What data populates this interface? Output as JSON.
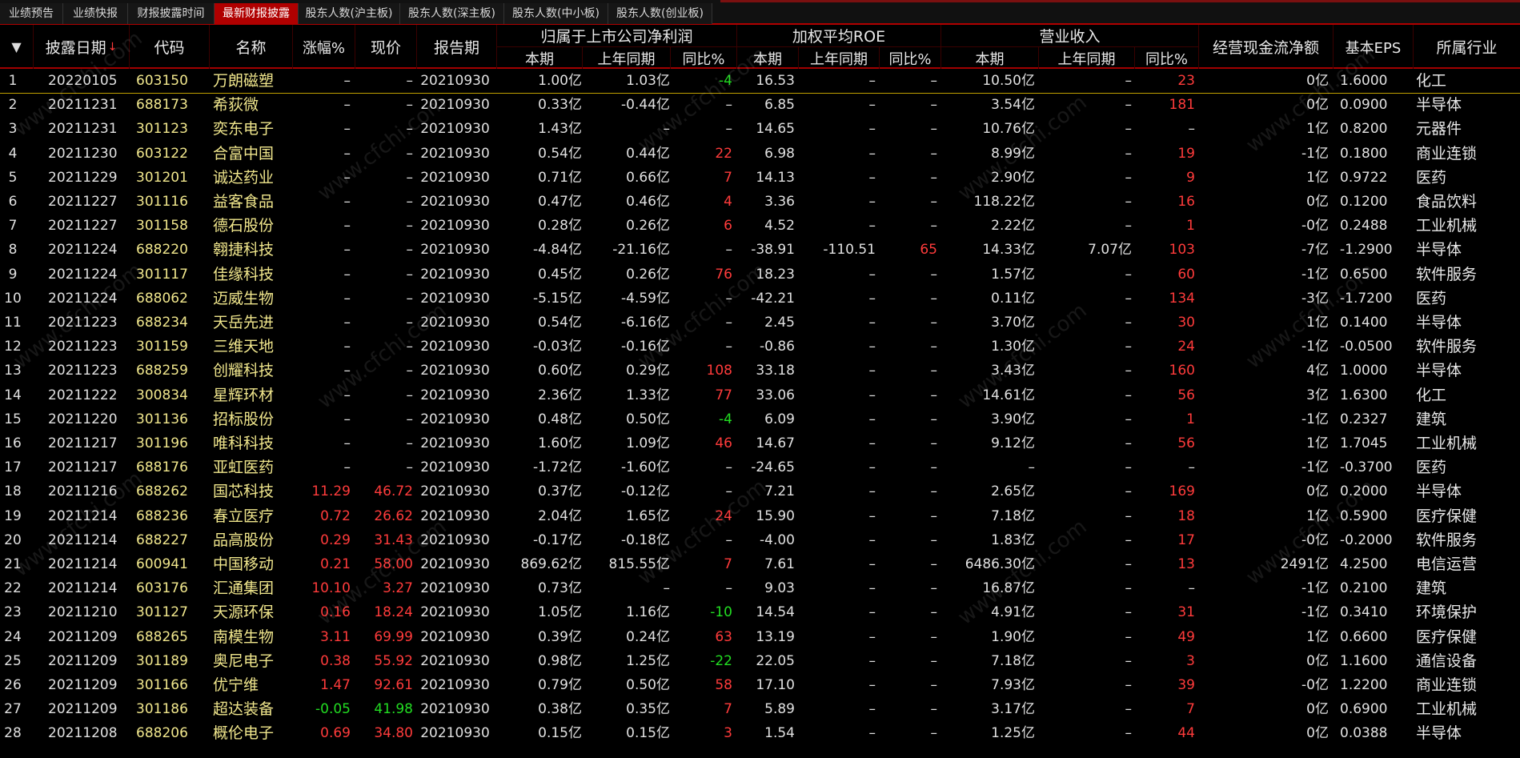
{
  "tabs": [
    "业绩预告",
    "业绩快报",
    "财报披露时间",
    "最新财报披露",
    "股东人数(沪主板)",
    "股东人数(深主板)",
    "股东人数(中小板)",
    "股东人数(创业板)"
  ],
  "active_tab": 3,
  "header": {
    "menu_icon": "▼",
    "date": "披露日期",
    "sort_icon": "↓",
    "code": "代码",
    "name": "名称",
    "change": "涨幅%",
    "price": "现价",
    "period": "报告期",
    "net_profit_group": "归属于上市公司净利润",
    "roe_group": "加权平均ROE",
    "revenue_group": "营业收入",
    "current": "本期",
    "prev": "上年同期",
    "yoy": "同比%",
    "cashflow": "经营现金流净额",
    "eps": "基本EPS",
    "industry": "所属行业"
  },
  "watermark": "www.cfchi.com",
  "colors": {
    "red": "#ff3b3b",
    "green": "#22dd22",
    "default": "#e0e0e0",
    "name": "#f0e68c",
    "accent": "#b00000"
  },
  "rows": [
    {
      "idx": "1",
      "date": "20220105",
      "code": "603150",
      "name": "万朗磁塑",
      "chg": "–",
      "price": "–",
      "period": "20210930",
      "np_cur": "1.00亿",
      "np_prev": "1.03亿",
      "np_yoy": "-4",
      "np_yoy_c": "green",
      "roe_cur": "16.53",
      "roe_prev": "–",
      "roe_yoy": "–",
      "roe_yoy_c": "",
      "rev_cur": "10.50亿",
      "rev_prev": "–",
      "rev_yoy": "23",
      "rev_yoy_c": "red",
      "cash": "0亿",
      "eps": "1.6000",
      "ind": "化工",
      "chg_c": ""
    },
    {
      "idx": "2",
      "date": "20211231",
      "code": "688173",
      "name": "希荻微",
      "chg": "–",
      "price": "–",
      "period": "20210930",
      "np_cur": "0.33亿",
      "np_prev": "-0.44亿",
      "np_yoy": "–",
      "np_yoy_c": "",
      "roe_cur": "6.85",
      "roe_prev": "–",
      "roe_yoy": "–",
      "roe_yoy_c": "",
      "rev_cur": "3.54亿",
      "rev_prev": "–",
      "rev_yoy": "181",
      "rev_yoy_c": "red",
      "cash": "0亿",
      "eps": "0.0900",
      "ind": "半导体",
      "chg_c": ""
    },
    {
      "idx": "3",
      "date": "20211231",
      "code": "301123",
      "name": "奕东电子",
      "chg": "–",
      "price": "–",
      "period": "20210930",
      "np_cur": "1.43亿",
      "np_prev": "–",
      "np_yoy": "–",
      "np_yoy_c": "",
      "roe_cur": "14.65",
      "roe_prev": "–",
      "roe_yoy": "–",
      "roe_yoy_c": "",
      "rev_cur": "10.76亿",
      "rev_prev": "–",
      "rev_yoy": "–",
      "rev_yoy_c": "",
      "cash": "1亿",
      "eps": "0.8200",
      "ind": "元器件",
      "chg_c": ""
    },
    {
      "idx": "4",
      "date": "20211230",
      "code": "603122",
      "name": "合富中国",
      "chg": "–",
      "price": "–",
      "period": "20210930",
      "np_cur": "0.54亿",
      "np_prev": "0.44亿",
      "np_yoy": "22",
      "np_yoy_c": "red",
      "roe_cur": "6.98",
      "roe_prev": "–",
      "roe_yoy": "–",
      "roe_yoy_c": "",
      "rev_cur": "8.99亿",
      "rev_prev": "–",
      "rev_yoy": "19",
      "rev_yoy_c": "red",
      "cash": "-1亿",
      "eps": "0.1800",
      "ind": "商业连锁",
      "chg_c": ""
    },
    {
      "idx": "5",
      "date": "20211229",
      "code": "301201",
      "name": "诚达药业",
      "chg": "–",
      "price": "–",
      "period": "20210930",
      "np_cur": "0.71亿",
      "np_prev": "0.66亿",
      "np_yoy": "7",
      "np_yoy_c": "red",
      "roe_cur": "14.13",
      "roe_prev": "–",
      "roe_yoy": "–",
      "roe_yoy_c": "",
      "rev_cur": "2.90亿",
      "rev_prev": "–",
      "rev_yoy": "9",
      "rev_yoy_c": "red",
      "cash": "1亿",
      "eps": "0.9722",
      "ind": "医药",
      "chg_c": ""
    },
    {
      "idx": "6",
      "date": "20211227",
      "code": "301116",
      "name": "益客食品",
      "chg": "–",
      "price": "–",
      "period": "20210930",
      "np_cur": "0.47亿",
      "np_prev": "0.46亿",
      "np_yoy": "4",
      "np_yoy_c": "red",
      "roe_cur": "3.36",
      "roe_prev": "–",
      "roe_yoy": "–",
      "roe_yoy_c": "",
      "rev_cur": "118.22亿",
      "rev_prev": "–",
      "rev_yoy": "16",
      "rev_yoy_c": "red",
      "cash": "0亿",
      "eps": "0.1200",
      "ind": "食品饮料",
      "chg_c": ""
    },
    {
      "idx": "7",
      "date": "20211227",
      "code": "301158",
      "name": "德石股份",
      "chg": "–",
      "price": "–",
      "period": "20210930",
      "np_cur": "0.28亿",
      "np_prev": "0.26亿",
      "np_yoy": "6",
      "np_yoy_c": "red",
      "roe_cur": "4.52",
      "roe_prev": "–",
      "roe_yoy": "–",
      "roe_yoy_c": "",
      "rev_cur": "2.22亿",
      "rev_prev": "–",
      "rev_yoy": "1",
      "rev_yoy_c": "red",
      "cash": "-0亿",
      "eps": "0.2488",
      "ind": "工业机械",
      "chg_c": ""
    },
    {
      "idx": "8",
      "date": "20211224",
      "code": "688220",
      "name": "翱捷科技",
      "chg": "–",
      "price": "–",
      "period": "20210930",
      "np_cur": "-4.84亿",
      "np_prev": "-21.16亿",
      "np_yoy": "–",
      "np_yoy_c": "",
      "roe_cur": "-38.91",
      "roe_prev": "-110.51",
      "roe_yoy": "65",
      "roe_yoy_c": "red",
      "rev_cur": "14.33亿",
      "rev_prev": "7.07亿",
      "rev_yoy": "103",
      "rev_yoy_c": "red",
      "cash": "-7亿",
      "eps": "-1.2900",
      "ind": "半导体",
      "chg_c": ""
    },
    {
      "idx": "9",
      "date": "20211224",
      "code": "301117",
      "name": "佳缘科技",
      "chg": "–",
      "price": "–",
      "period": "20210930",
      "np_cur": "0.45亿",
      "np_prev": "0.26亿",
      "np_yoy": "76",
      "np_yoy_c": "red",
      "roe_cur": "18.23",
      "roe_prev": "–",
      "roe_yoy": "–",
      "roe_yoy_c": "",
      "rev_cur": "1.57亿",
      "rev_prev": "–",
      "rev_yoy": "60",
      "rev_yoy_c": "red",
      "cash": "-1亿",
      "eps": "0.6500",
      "ind": "软件服务",
      "chg_c": ""
    },
    {
      "idx": "10",
      "date": "20211224",
      "code": "688062",
      "name": "迈威生物",
      "chg": "–",
      "price": "–",
      "period": "20210930",
      "np_cur": "-5.15亿",
      "np_prev": "-4.59亿",
      "np_yoy": "–",
      "np_yoy_c": "",
      "roe_cur": "-42.21",
      "roe_prev": "–",
      "roe_yoy": "–",
      "roe_yoy_c": "",
      "rev_cur": "0.11亿",
      "rev_prev": "–",
      "rev_yoy": "134",
      "rev_yoy_c": "red",
      "cash": "-3亿",
      "eps": "-1.7200",
      "ind": "医药",
      "chg_c": ""
    },
    {
      "idx": "11",
      "date": "20211223",
      "code": "688234",
      "name": "天岳先进",
      "chg": "–",
      "price": "–",
      "period": "20210930",
      "np_cur": "0.54亿",
      "np_prev": "-6.16亿",
      "np_yoy": "–",
      "np_yoy_c": "",
      "roe_cur": "2.45",
      "roe_prev": "–",
      "roe_yoy": "–",
      "roe_yoy_c": "",
      "rev_cur": "3.70亿",
      "rev_prev": "–",
      "rev_yoy": "30",
      "rev_yoy_c": "red",
      "cash": "1亿",
      "eps": "0.1400",
      "ind": "半导体",
      "chg_c": ""
    },
    {
      "idx": "12",
      "date": "20211223",
      "code": "301159",
      "name": "三维天地",
      "chg": "–",
      "price": "–",
      "period": "20210930",
      "np_cur": "-0.03亿",
      "np_prev": "-0.16亿",
      "np_yoy": "–",
      "np_yoy_c": "",
      "roe_cur": "-0.86",
      "roe_prev": "–",
      "roe_yoy": "–",
      "roe_yoy_c": "",
      "rev_cur": "1.30亿",
      "rev_prev": "–",
      "rev_yoy": "24",
      "rev_yoy_c": "red",
      "cash": "-1亿",
      "eps": "-0.0500",
      "ind": "软件服务",
      "chg_c": ""
    },
    {
      "idx": "13",
      "date": "20211223",
      "code": "688259",
      "name": "创耀科技",
      "chg": "–",
      "price": "–",
      "period": "20210930",
      "np_cur": "0.60亿",
      "np_prev": "0.29亿",
      "np_yoy": "108",
      "np_yoy_c": "red",
      "roe_cur": "33.18",
      "roe_prev": "–",
      "roe_yoy": "–",
      "roe_yoy_c": "",
      "rev_cur": "3.43亿",
      "rev_prev": "–",
      "rev_yoy": "160",
      "rev_yoy_c": "red",
      "cash": "4亿",
      "eps": "1.0000",
      "ind": "半导体",
      "chg_c": ""
    },
    {
      "idx": "14",
      "date": "20211222",
      "code": "300834",
      "name": "星辉环材",
      "chg": "–",
      "price": "–",
      "period": "20210930",
      "np_cur": "2.36亿",
      "np_prev": "1.33亿",
      "np_yoy": "77",
      "np_yoy_c": "red",
      "roe_cur": "33.06",
      "roe_prev": "–",
      "roe_yoy": "–",
      "roe_yoy_c": "",
      "rev_cur": "14.61亿",
      "rev_prev": "–",
      "rev_yoy": "56",
      "rev_yoy_c": "red",
      "cash": "3亿",
      "eps": "1.6300",
      "ind": "化工",
      "chg_c": ""
    },
    {
      "idx": "15",
      "date": "20211220",
      "code": "301136",
      "name": "招标股份",
      "chg": "–",
      "price": "–",
      "period": "20210930",
      "np_cur": "0.48亿",
      "np_prev": "0.50亿",
      "np_yoy": "-4",
      "np_yoy_c": "green",
      "roe_cur": "6.09",
      "roe_prev": "–",
      "roe_yoy": "–",
      "roe_yoy_c": "",
      "rev_cur": "3.90亿",
      "rev_prev": "–",
      "rev_yoy": "1",
      "rev_yoy_c": "red",
      "cash": "-1亿",
      "eps": "0.2327",
      "ind": "建筑",
      "chg_c": ""
    },
    {
      "idx": "16",
      "date": "20211217",
      "code": "301196",
      "name": "唯科科技",
      "chg": "–",
      "price": "–",
      "period": "20210930",
      "np_cur": "1.60亿",
      "np_prev": "1.09亿",
      "np_yoy": "46",
      "np_yoy_c": "red",
      "roe_cur": "14.67",
      "roe_prev": "–",
      "roe_yoy": "–",
      "roe_yoy_c": "",
      "rev_cur": "9.12亿",
      "rev_prev": "–",
      "rev_yoy": "56",
      "rev_yoy_c": "red",
      "cash": "1亿",
      "eps": "1.7045",
      "ind": "工业机械",
      "chg_c": ""
    },
    {
      "idx": "17",
      "date": "20211217",
      "code": "688176",
      "name": "亚虹医药",
      "chg": "–",
      "price": "–",
      "period": "20210930",
      "np_cur": "-1.72亿",
      "np_prev": "-1.60亿",
      "np_yoy": "–",
      "np_yoy_c": "",
      "roe_cur": "-24.65",
      "roe_prev": "–",
      "roe_yoy": "–",
      "roe_yoy_c": "",
      "rev_cur": "–",
      "rev_prev": "–",
      "rev_yoy": "–",
      "rev_yoy_c": "",
      "cash": "-1亿",
      "eps": "-0.3700",
      "ind": "医药",
      "chg_c": ""
    },
    {
      "idx": "18",
      "date": "20211216",
      "code": "688262",
      "name": "国芯科技",
      "chg": "11.29",
      "price": "46.72",
      "period": "20210930",
      "np_cur": "0.37亿",
      "np_prev": "-0.12亿",
      "np_yoy": "–",
      "np_yoy_c": "",
      "roe_cur": "7.21",
      "roe_prev": "–",
      "roe_yoy": "–",
      "roe_yoy_c": "",
      "rev_cur": "2.65亿",
      "rev_prev": "–",
      "rev_yoy": "169",
      "rev_yoy_c": "red",
      "cash": "0亿",
      "eps": "0.2000",
      "ind": "半导体",
      "chg_c": "red"
    },
    {
      "idx": "19",
      "date": "20211214",
      "code": "688236",
      "name": "春立医疗",
      "chg": "0.72",
      "price": "26.62",
      "period": "20210930",
      "np_cur": "2.04亿",
      "np_prev": "1.65亿",
      "np_yoy": "24",
      "np_yoy_c": "red",
      "roe_cur": "15.90",
      "roe_prev": "–",
      "roe_yoy": "–",
      "roe_yoy_c": "",
      "rev_cur": "7.18亿",
      "rev_prev": "–",
      "rev_yoy": "18",
      "rev_yoy_c": "red",
      "cash": "1亿",
      "eps": "0.5900",
      "ind": "医疗保健",
      "chg_c": "red"
    },
    {
      "idx": "20",
      "date": "20211214",
      "code": "688227",
      "name": "品高股份",
      "chg": "0.29",
      "price": "31.43",
      "period": "20210930",
      "np_cur": "-0.17亿",
      "np_prev": "-0.18亿",
      "np_yoy": "–",
      "np_yoy_c": "",
      "roe_cur": "-4.00",
      "roe_prev": "–",
      "roe_yoy": "–",
      "roe_yoy_c": "",
      "rev_cur": "1.83亿",
      "rev_prev": "–",
      "rev_yoy": "17",
      "rev_yoy_c": "red",
      "cash": "-0亿",
      "eps": "-0.2000",
      "ind": "软件服务",
      "chg_c": "red"
    },
    {
      "idx": "21",
      "date": "20211214",
      "code": "600941",
      "name": "中国移动",
      "chg": "0.21",
      "price": "58.00",
      "period": "20210930",
      "np_cur": "869.62亿",
      "np_prev": "815.55亿",
      "np_yoy": "7",
      "np_yoy_c": "red",
      "roe_cur": "7.61",
      "roe_prev": "–",
      "roe_yoy": "–",
      "roe_yoy_c": "",
      "rev_cur": "6486.30亿",
      "rev_prev": "–",
      "rev_yoy": "13",
      "rev_yoy_c": "red",
      "cash": "2491亿",
      "eps": "4.2500",
      "ind": "电信运营",
      "chg_c": "red"
    },
    {
      "idx": "22",
      "date": "20211214",
      "code": "603176",
      "name": "汇通集团",
      "chg": "10.10",
      "price": "3.27",
      "period": "20210930",
      "np_cur": "0.73亿",
      "np_prev": "–",
      "np_yoy": "–",
      "np_yoy_c": "",
      "roe_cur": "9.03",
      "roe_prev": "–",
      "roe_yoy": "–",
      "roe_yoy_c": "",
      "rev_cur": "16.87亿",
      "rev_prev": "–",
      "rev_yoy": "–",
      "rev_yoy_c": "",
      "cash": "-1亿",
      "eps": "0.2100",
      "ind": "建筑",
      "chg_c": "red"
    },
    {
      "idx": "23",
      "date": "20211210",
      "code": "301127",
      "name": "天源环保",
      "chg": "0.16",
      "price": "18.24",
      "period": "20210930",
      "np_cur": "1.05亿",
      "np_prev": "1.16亿",
      "np_yoy": "-10",
      "np_yoy_c": "green",
      "roe_cur": "14.54",
      "roe_prev": "–",
      "roe_yoy": "–",
      "roe_yoy_c": "",
      "rev_cur": "4.91亿",
      "rev_prev": "–",
      "rev_yoy": "31",
      "rev_yoy_c": "red",
      "cash": "-1亿",
      "eps": "0.3410",
      "ind": "环境保护",
      "chg_c": "red"
    },
    {
      "idx": "24",
      "date": "20211209",
      "code": "688265",
      "name": "南模生物",
      "chg": "3.11",
      "price": "69.99",
      "period": "20210930",
      "np_cur": "0.39亿",
      "np_prev": "0.24亿",
      "np_yoy": "63",
      "np_yoy_c": "red",
      "roe_cur": "13.19",
      "roe_prev": "–",
      "roe_yoy": "–",
      "roe_yoy_c": "",
      "rev_cur": "1.90亿",
      "rev_prev": "–",
      "rev_yoy": "49",
      "rev_yoy_c": "red",
      "cash": "1亿",
      "eps": "0.6600",
      "ind": "医疗保健",
      "chg_c": "red"
    },
    {
      "idx": "25",
      "date": "20211209",
      "code": "301189",
      "name": "奥尼电子",
      "chg": "0.38",
      "price": "55.92",
      "period": "20210930",
      "np_cur": "0.98亿",
      "np_prev": "1.25亿",
      "np_yoy": "-22",
      "np_yoy_c": "green",
      "roe_cur": "22.05",
      "roe_prev": "–",
      "roe_yoy": "–",
      "roe_yoy_c": "",
      "rev_cur": "7.18亿",
      "rev_prev": "–",
      "rev_yoy": "3",
      "rev_yoy_c": "red",
      "cash": "0亿",
      "eps": "1.1600",
      "ind": "通信设备",
      "chg_c": "red"
    },
    {
      "idx": "26",
      "date": "20211209",
      "code": "301166",
      "name": "优宁维",
      "chg": "1.47",
      "price": "92.61",
      "period": "20210930",
      "np_cur": "0.79亿",
      "np_prev": "0.50亿",
      "np_yoy": "58",
      "np_yoy_c": "red",
      "roe_cur": "17.10",
      "roe_prev": "–",
      "roe_yoy": "–",
      "roe_yoy_c": "",
      "rev_cur": "7.93亿",
      "rev_prev": "–",
      "rev_yoy": "39",
      "rev_yoy_c": "red",
      "cash": "-0亿",
      "eps": "1.2200",
      "ind": "商业连锁",
      "chg_c": "red"
    },
    {
      "idx": "27",
      "date": "20211209",
      "code": "301186",
      "name": "超达装备",
      "chg": "-0.05",
      "price": "41.98",
      "period": "20210930",
      "np_cur": "0.38亿",
      "np_prev": "0.35亿",
      "np_yoy": "7",
      "np_yoy_c": "red",
      "roe_cur": "5.89",
      "roe_prev": "–",
      "roe_yoy": "–",
      "roe_yoy_c": "",
      "rev_cur": "3.17亿",
      "rev_prev": "–",
      "rev_yoy": "7",
      "rev_yoy_c": "red",
      "cash": "0亿",
      "eps": "0.6900",
      "ind": "工业机械",
      "chg_c": "green"
    },
    {
      "idx": "28",
      "date": "20211208",
      "code": "688206",
      "name": "概伦电子",
      "chg": "0.69",
      "price": "34.80",
      "period": "20210930",
      "np_cur": "0.15亿",
      "np_prev": "0.15亿",
      "np_yoy": "3",
      "np_yoy_c": "red",
      "roe_cur": "1.54",
      "roe_prev": "–",
      "roe_yoy": "–",
      "roe_yoy_c": "",
      "rev_cur": "1.25亿",
      "rev_prev": "–",
      "rev_yoy": "44",
      "rev_yoy_c": "red",
      "cash": "0亿",
      "eps": "0.0388",
      "ind": "半导体",
      "chg_c": "red"
    }
  ]
}
